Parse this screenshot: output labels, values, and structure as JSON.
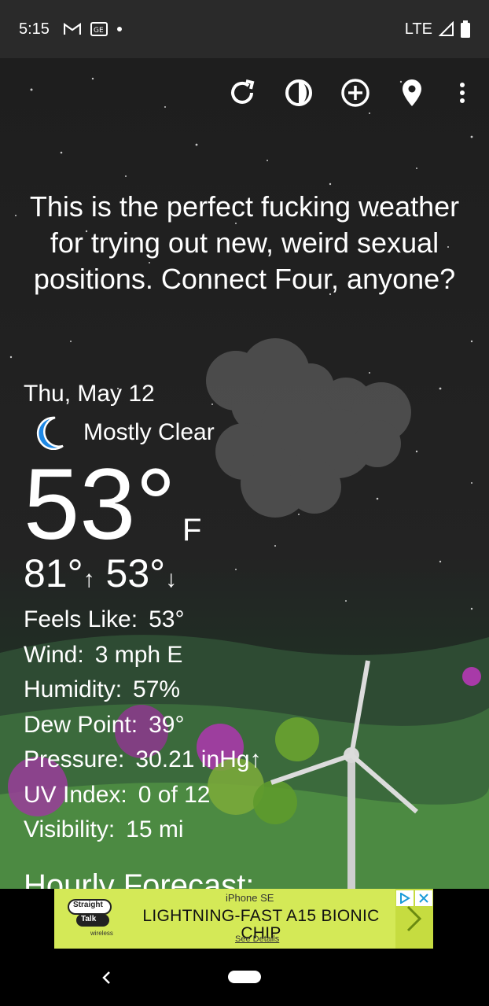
{
  "status_bar": {
    "time": "5:15",
    "network": "LTE",
    "icons": [
      "gmail-icon",
      "news-icon",
      "notification-dot-icon",
      "signal-icon",
      "battery-icon"
    ]
  },
  "toolbar": {
    "icons": [
      "refresh-icon",
      "theme-icon",
      "add-location-icon",
      "location-pin-icon",
      "more-vert-icon"
    ]
  },
  "headline": "This is the perfect fucking weather for trying out new, weird sexual positions. Connect Four, anyone?",
  "current": {
    "date": "Thu, May 12",
    "condition": "Mostly Clear",
    "condition_icon": "moon-icon",
    "temperature": "53°",
    "unit": "F",
    "high": "81°",
    "high_arrow": "↑",
    "low": "53°",
    "low_arrow": "↓"
  },
  "details": [
    {
      "label": "Feels Like:",
      "value": "53°"
    },
    {
      "label": "Wind:",
      "value": "3 mph E"
    },
    {
      "label": "Humidity:",
      "value": "57%"
    },
    {
      "label": "Dew Point:",
      "value": "39°"
    },
    {
      "label": "Pressure:",
      "value": "30.21 inHg↑"
    },
    {
      "label": "UV Index:",
      "value": "0 of 12"
    },
    {
      "label": "Visibility:",
      "value": "15 mi"
    }
  ],
  "hourly_heading": "Hourly Forecast:",
  "ad": {
    "brand_line1": "Straight",
    "brand_line2": "Talk",
    "brand_line3": "wireless",
    "product": "iPhone SE",
    "headline": "LIGHTNING-FAST A15 BIONIC CHIP",
    "subtext": "See Details",
    "colors": {
      "background": "#d4e957",
      "chevron": "#c6dc40"
    }
  },
  "colors": {
    "moon": "#1e88e5",
    "cloud": "#5a5a5a"
  }
}
